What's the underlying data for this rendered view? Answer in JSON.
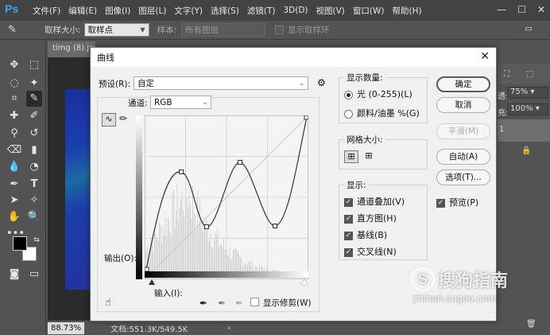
{
  "menubar": {
    "logo": "Ps",
    "items": [
      "文件(F)",
      "编辑(E)",
      "图像(I)",
      "图层(L)",
      "文字(Y)",
      "选择(S)",
      "滤镜(T)",
      "3D(D)",
      "视图(V)",
      "窗口(W)",
      "帮助(H)"
    ]
  },
  "optionsbar": {
    "sample_size_label": "取样大小:",
    "sample_size_value": "取样点",
    "sample_label": "样本:",
    "sample_value": "所有图层",
    "show_ring_label": "显示取样环"
  },
  "document": {
    "tab_title": "timg (8).jpg",
    "zoom": "88.73%",
    "doc_info": "文档:551.3K/549.5K"
  },
  "rightpanel": {
    "opacity_label": "透:",
    "opacity_value": "75%",
    "fill_label": "充:",
    "fill_value": "100%",
    "layer_num": "1"
  },
  "dialog": {
    "title": "曲线",
    "preset_label": "预设(R):",
    "preset_value": "自定",
    "channel_label": "通道:",
    "channel_value": "RGB",
    "output_label": "输出(O):",
    "input_label": "输入(I):",
    "show_clipping_label": "显示修剪(W)",
    "show_amount": {
      "title": "显示数量:",
      "light": "光 (0-255)(L)",
      "pigment": "颜料/油墨 %(G)"
    },
    "grid_size_title": "网格大小:",
    "display": {
      "title": "显示:",
      "channel_overlay": "通道叠加(V)",
      "histogram": "直方图(H)",
      "baseline": "基线(B)",
      "intersection": "交叉线(N)"
    },
    "buttons": {
      "ok": "确定",
      "cancel": "取消",
      "smooth": "平滑(M)",
      "auto": "自动(A)",
      "options": "选项(T)..."
    },
    "preview_label": "预览(P)"
  },
  "watermark": {
    "brand": "搜狗指南",
    "url": "zhinan.sogou.com"
  },
  "colors": {
    "accent": "#31a8ff",
    "dialog_bg": "#f0f0f0",
    "graph_bg": "#f4f4f4"
  }
}
